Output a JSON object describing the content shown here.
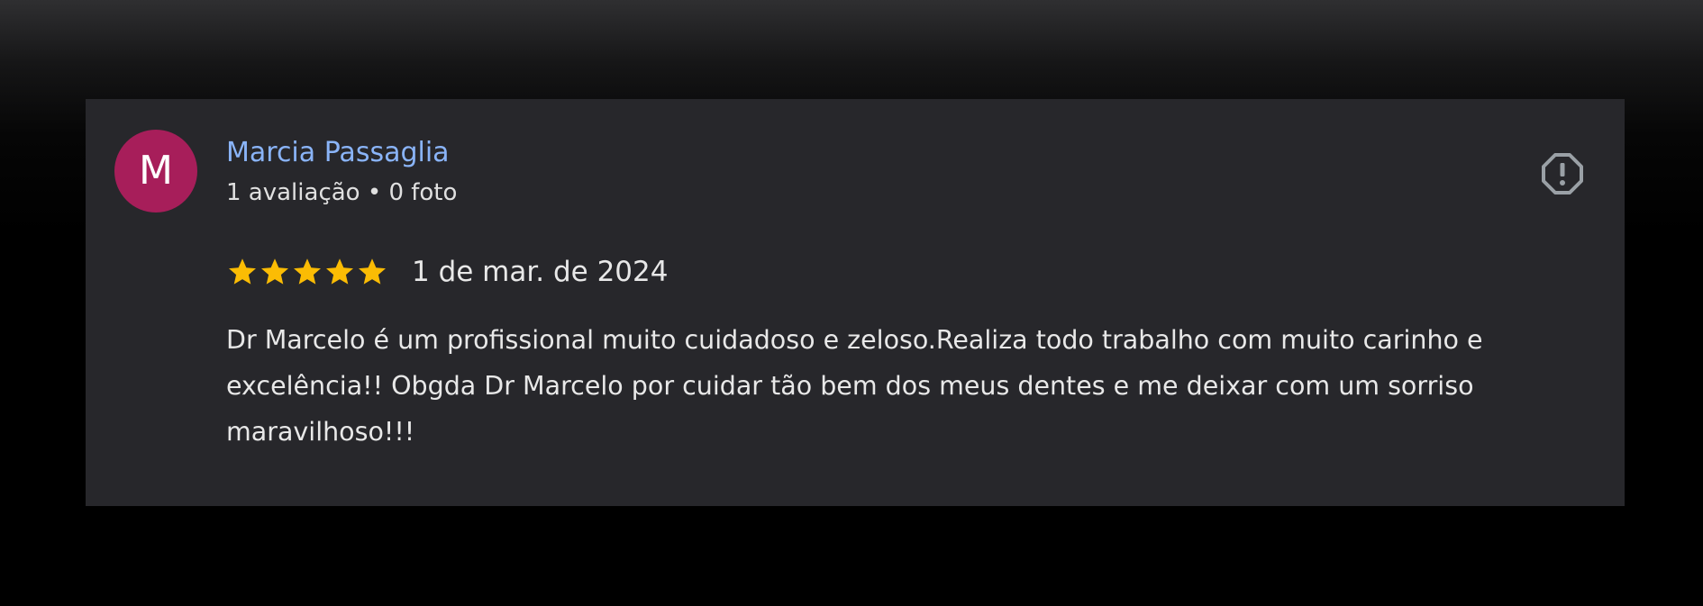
{
  "review": {
    "avatar_letter": "M",
    "avatar_color": "#a71e5a",
    "name_color": "#8ab4f8",
    "star_color": "#fbbc04",
    "reviewer_name": "Marcia Passaglia",
    "reviewer_meta": "1 avaliação • 0 foto",
    "rating": 5,
    "rating_max": 5,
    "date": "1 de mar. de 2024",
    "text": "Dr Marcelo é um profissional muito cuidadoso e zeloso.Realiza todo trabalho com muito carinho e excelência!! Obgda Dr Marcelo por cuidar tão bem dos meus dentes e me deixar com um sorriso maravilhoso!!!",
    "report_icon": "report-icon"
  }
}
